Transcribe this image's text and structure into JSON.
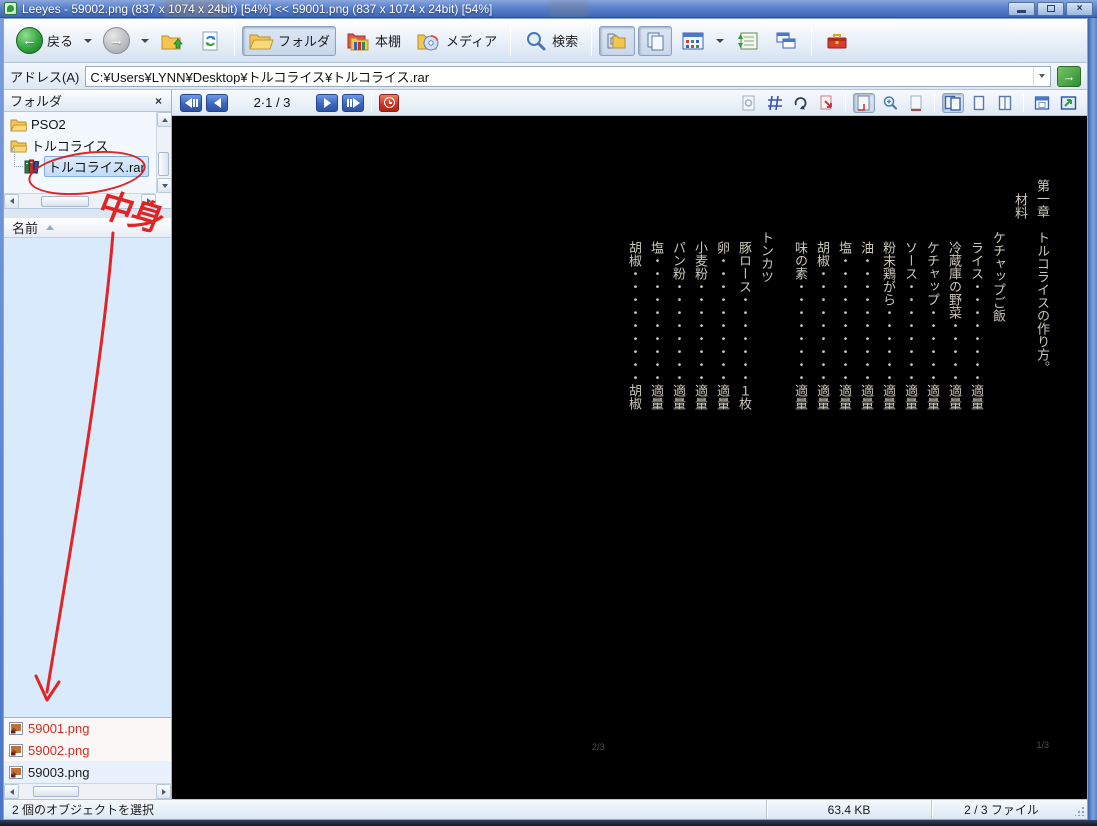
{
  "window": {
    "title": "Leeyes - 59002.png (837 x 1074 x 24bit) [54%]   <<   59001.png (837 x 1074 x 24bit) [54%]"
  },
  "toolbar": {
    "back_label": "戻る",
    "folder_label": "フォルダ",
    "bookshelf_label": "本棚",
    "media_label": "メディア",
    "search_label": "検索"
  },
  "address_bar": {
    "label": "アドレス(A)",
    "value": "C:¥Users¥LYNN¥Desktop¥トルコライス¥トルコライス.rar"
  },
  "folder_panel": {
    "title": "フォルダ",
    "tree": [
      {
        "label": "PSO2",
        "icon": "folder"
      },
      {
        "label": "トルコライス",
        "icon": "folder"
      },
      {
        "label": "トルコライス.rar",
        "icon": "archive-books",
        "selected": true
      }
    ]
  },
  "file_list": {
    "column_header": "名前",
    "files": [
      {
        "name": "59001.png",
        "state": "selected"
      },
      {
        "name": "59002.png",
        "state": "selected"
      },
      {
        "name": "59003.png",
        "state": "normal"
      }
    ]
  },
  "viewer": {
    "page_indicator": "2·1 / 3",
    "left_page_number": "2/3",
    "right_page_number": "1/3",
    "page_text": {
      "columns": [
        {
          "text": "第一章　トルコライスの作り方。",
          "type": "chapter"
        },
        {
          "text": "材料",
          "type": "section"
        },
        {
          "text": "ケチャップご飯",
          "type": "header"
        },
        {
          "text": "ライス・・・・・・・・適量",
          "type": "item"
        },
        {
          "text": "冷蔵庫の野菜・・・・・適量",
          "type": "item"
        },
        {
          "text": "ケチャップ・・・・・・適量",
          "type": "item"
        },
        {
          "text": "ソース・・・・・・・・適量",
          "type": "item"
        },
        {
          "text": "粉末鶏がら・・・・・・適量",
          "type": "item"
        },
        {
          "text": "油・・・・・・・・・・適量",
          "type": "item"
        },
        {
          "text": "塩・・・・・・・・・・適量",
          "type": "item"
        },
        {
          "text": "胡椒・・・・・・・・・適量",
          "type": "item"
        },
        {
          "text": "味の素・・・・・・・・適量",
          "type": "item"
        },
        {
          "text": "トンカツ",
          "type": "header2"
        },
        {
          "text": "豚ロース・・・・・・・１枚",
          "type": "item"
        },
        {
          "text": "卵・・・・・・・・・・適量",
          "type": "item"
        },
        {
          "text": "小麦粉・・・・・・・・適量",
          "type": "item"
        },
        {
          "text": "パン粉・・・・・・・・適量",
          "type": "item"
        },
        {
          "text": "塩・・・・・・・・・・適量",
          "type": "item"
        },
        {
          "text": "胡椒・・・・・・・・・胡椒",
          "type": "item"
        }
      ]
    }
  },
  "status_bar": {
    "selection": "2 個のオブジェクトを選択",
    "size": "63.4 KB",
    "files": "2 / 3 ファイル"
  },
  "annotations": {
    "note": "中身",
    "color": "#e01414"
  }
}
